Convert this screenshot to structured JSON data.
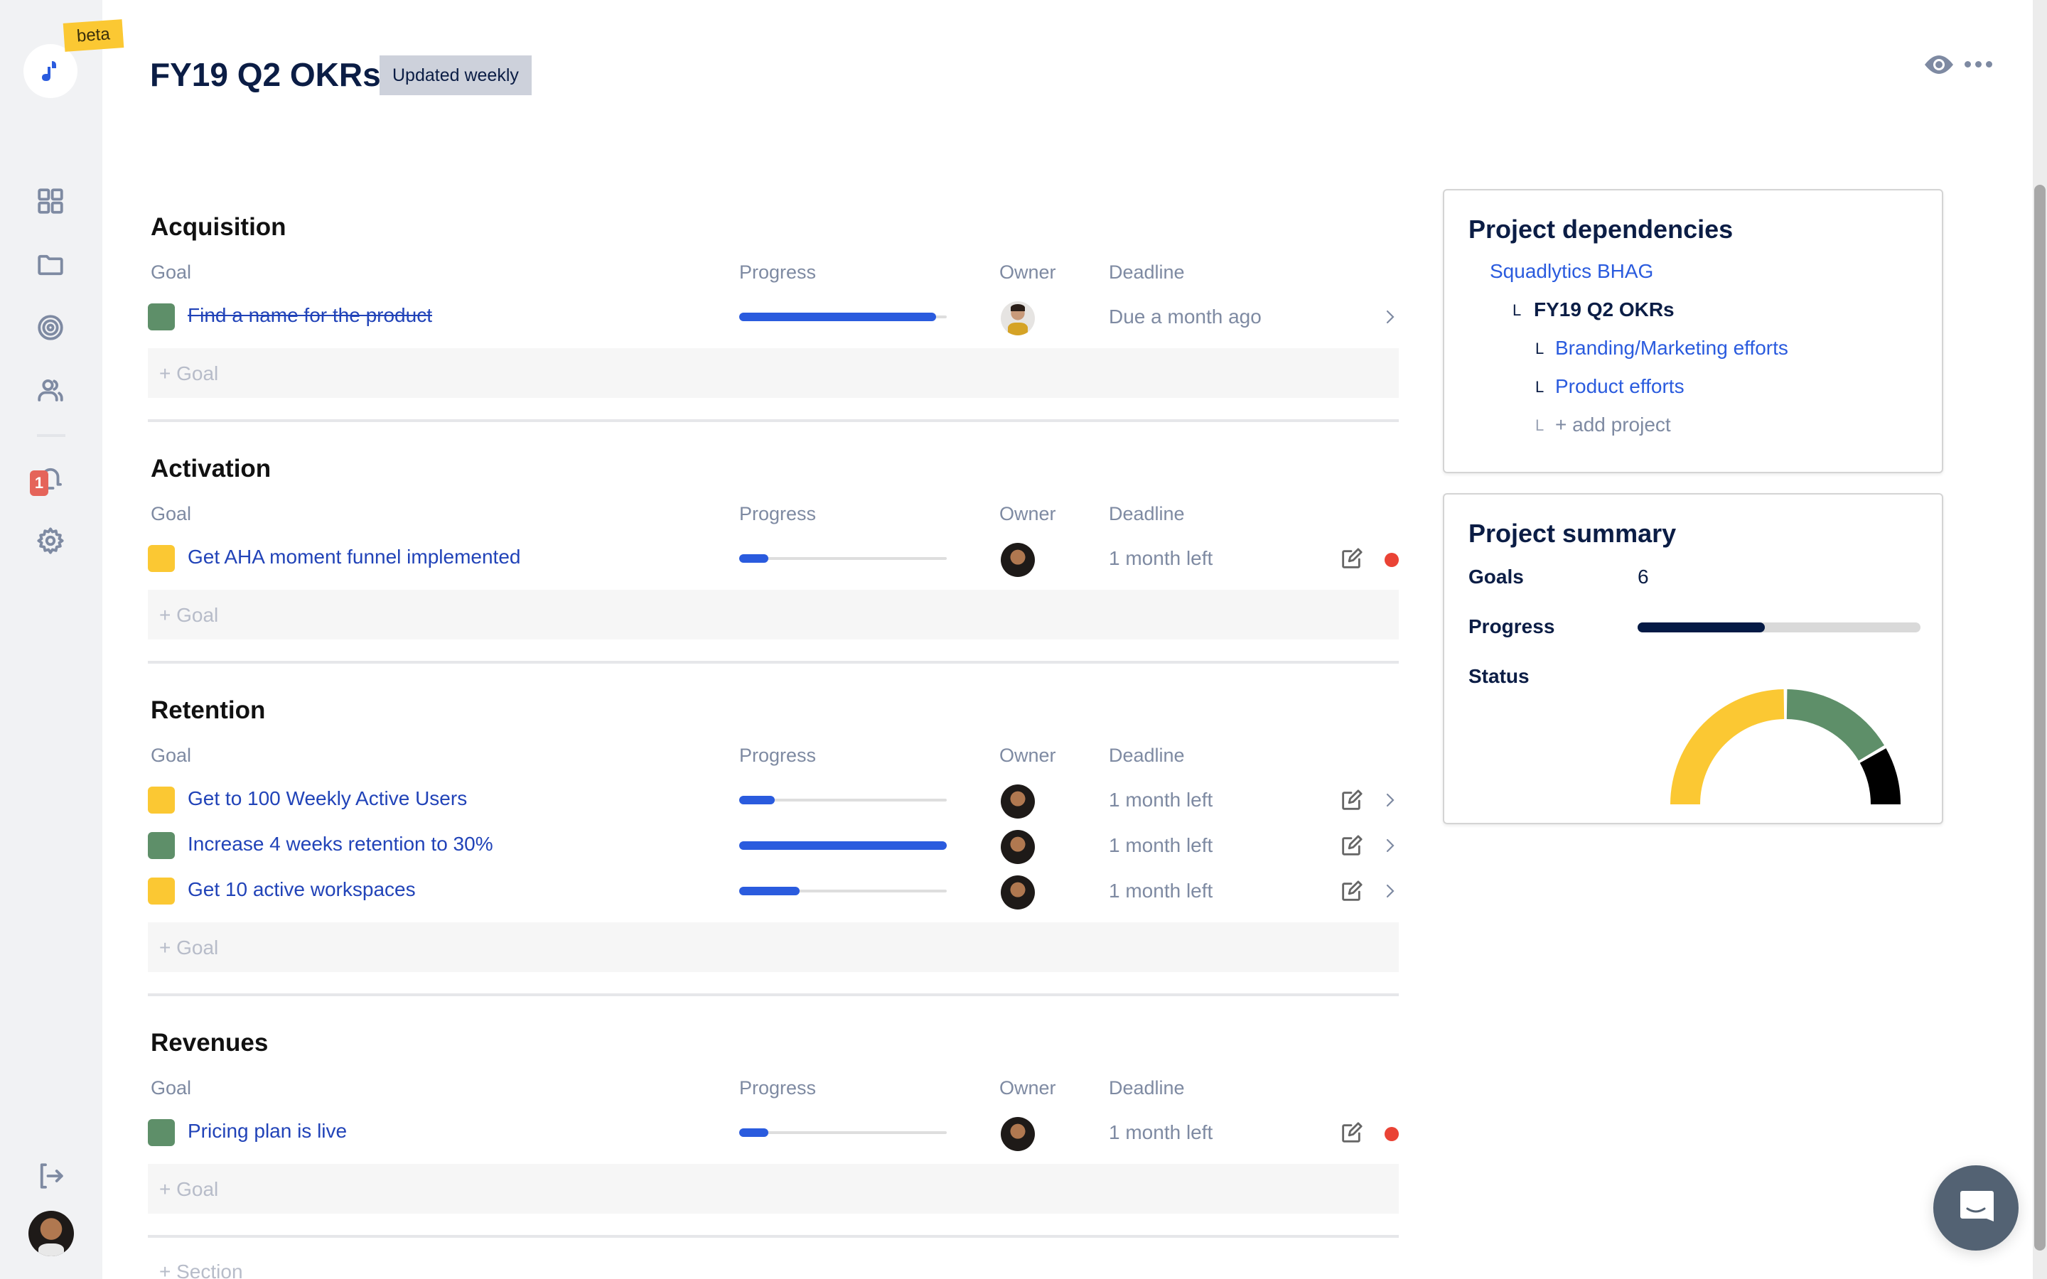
{
  "app": {
    "beta_label": "beta",
    "title": "FY19 Q2 OKRs",
    "title_badge": "Updated weekly"
  },
  "sidebar": {
    "items": [
      {
        "name": "dashboard",
        "icon": "grid-icon"
      },
      {
        "name": "projects",
        "icon": "folder-icon"
      },
      {
        "name": "goals",
        "icon": "target-icon"
      },
      {
        "name": "team",
        "icon": "users-icon"
      },
      {
        "name": "notifications",
        "icon": "bell-icon",
        "badge": "1"
      },
      {
        "name": "settings",
        "icon": "gear-icon"
      }
    ],
    "logout_icon": "logout-icon"
  },
  "columns": {
    "goal": "Goal",
    "progress": "Progress",
    "owner": "Owner",
    "deadline": "Deadline"
  },
  "add_goal_label": "+ Goal",
  "add_section_label": "+ Section",
  "colors": {
    "accent": "#2a5bde",
    "link": "#2143b8",
    "green": "#5e8f69",
    "yellow": "#fbc833",
    "red": "#ea4335",
    "navy": "#0b1d45"
  },
  "sections": [
    {
      "title": "Acquisition",
      "goals": [
        {
          "name": "Find a name for the product",
          "status": "green",
          "done": true,
          "progress": 0.95,
          "owner": "alt",
          "deadline": "Due a month ago",
          "edit": false,
          "chevron": true,
          "alert": false
        }
      ]
    },
    {
      "title": "Activation",
      "goals": [
        {
          "name": "Get AHA moment funnel implemented",
          "status": "yellow",
          "done": false,
          "progress": 0.14,
          "owner": "main",
          "deadline": "1 month left",
          "edit": true,
          "chevron": false,
          "alert": true
        }
      ]
    },
    {
      "title": "Retention",
      "goals": [
        {
          "name": "Get to 100 Weekly Active Users",
          "status": "yellow",
          "done": false,
          "progress": 0.17,
          "owner": "main",
          "deadline": "1 month left",
          "edit": true,
          "chevron": true,
          "alert": false
        },
        {
          "name": "Increase 4 weeks retention to 30%",
          "status": "green",
          "done": false,
          "progress": 1.0,
          "owner": "main",
          "deadline": "1 month left",
          "edit": true,
          "chevron": true,
          "alert": false
        },
        {
          "name": "Get 10 active workspaces",
          "status": "yellow",
          "done": false,
          "progress": 0.29,
          "owner": "main",
          "deadline": "1 month left",
          "edit": true,
          "chevron": true,
          "alert": false
        }
      ]
    },
    {
      "title": "Revenues",
      "goals": [
        {
          "name": "Pricing plan is live",
          "status": "green",
          "done": false,
          "progress": 0.14,
          "owner": "main",
          "deadline": "1 month left",
          "edit": true,
          "chevron": false,
          "alert": true
        }
      ]
    }
  ],
  "dependencies": {
    "title": "Project dependencies",
    "parent": "Squadlytics BHAG",
    "current": "FY19 Q2 OKRs",
    "children": [
      "Branding/Marketing efforts",
      "Product efforts"
    ],
    "add_label": "+ add project",
    "tick": "L"
  },
  "summary": {
    "title": "Project summary",
    "goals_label": "Goals",
    "goals_value": "6",
    "progress_label": "Progress",
    "progress_value": 0.45,
    "status_label": "Status",
    "status_breakdown": [
      {
        "status": "at-risk",
        "color": "#fbc833",
        "count": 3
      },
      {
        "status": "on-track",
        "color": "#5e8f69",
        "count": 2
      },
      {
        "status": "off-track",
        "color": "#000000",
        "count": 1
      }
    ]
  }
}
